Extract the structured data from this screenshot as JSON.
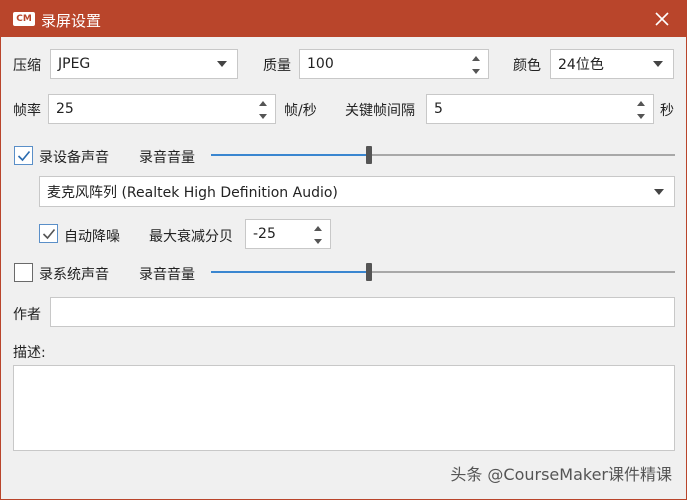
{
  "window": {
    "title": "录屏设置",
    "logo_text": "CM",
    "accent": "#b9452b"
  },
  "compression": {
    "label": "压缩",
    "value": "JPEG"
  },
  "quality": {
    "label": "质量",
    "value": "100"
  },
  "color": {
    "label": "颜色",
    "value": "24位色"
  },
  "framerate": {
    "label": "帧率",
    "value": "25",
    "unit": "帧/秒"
  },
  "keyframe": {
    "label": "关键帧间隔",
    "value": "5",
    "unit": "秒"
  },
  "device_audio": {
    "checkbox_label": "录设备声音",
    "checked": true,
    "volume_label": "录音音量",
    "volume_level": 0.34,
    "device": "麦克风阵列 (Realtek High Definition Audio)"
  },
  "denoise": {
    "checkbox_label": "自动降噪",
    "checked": true,
    "max_decay_label": "最大衰减分贝",
    "max_decay_value": "-25"
  },
  "system_audio": {
    "checkbox_label": "录系统声音",
    "checked": false,
    "volume_label": "录音音量",
    "volume_level": 0.34
  },
  "author": {
    "label": "作者",
    "value": ""
  },
  "description": {
    "label": "描述:",
    "value": ""
  },
  "watermark": "头条 @CourseMaker课件精课"
}
